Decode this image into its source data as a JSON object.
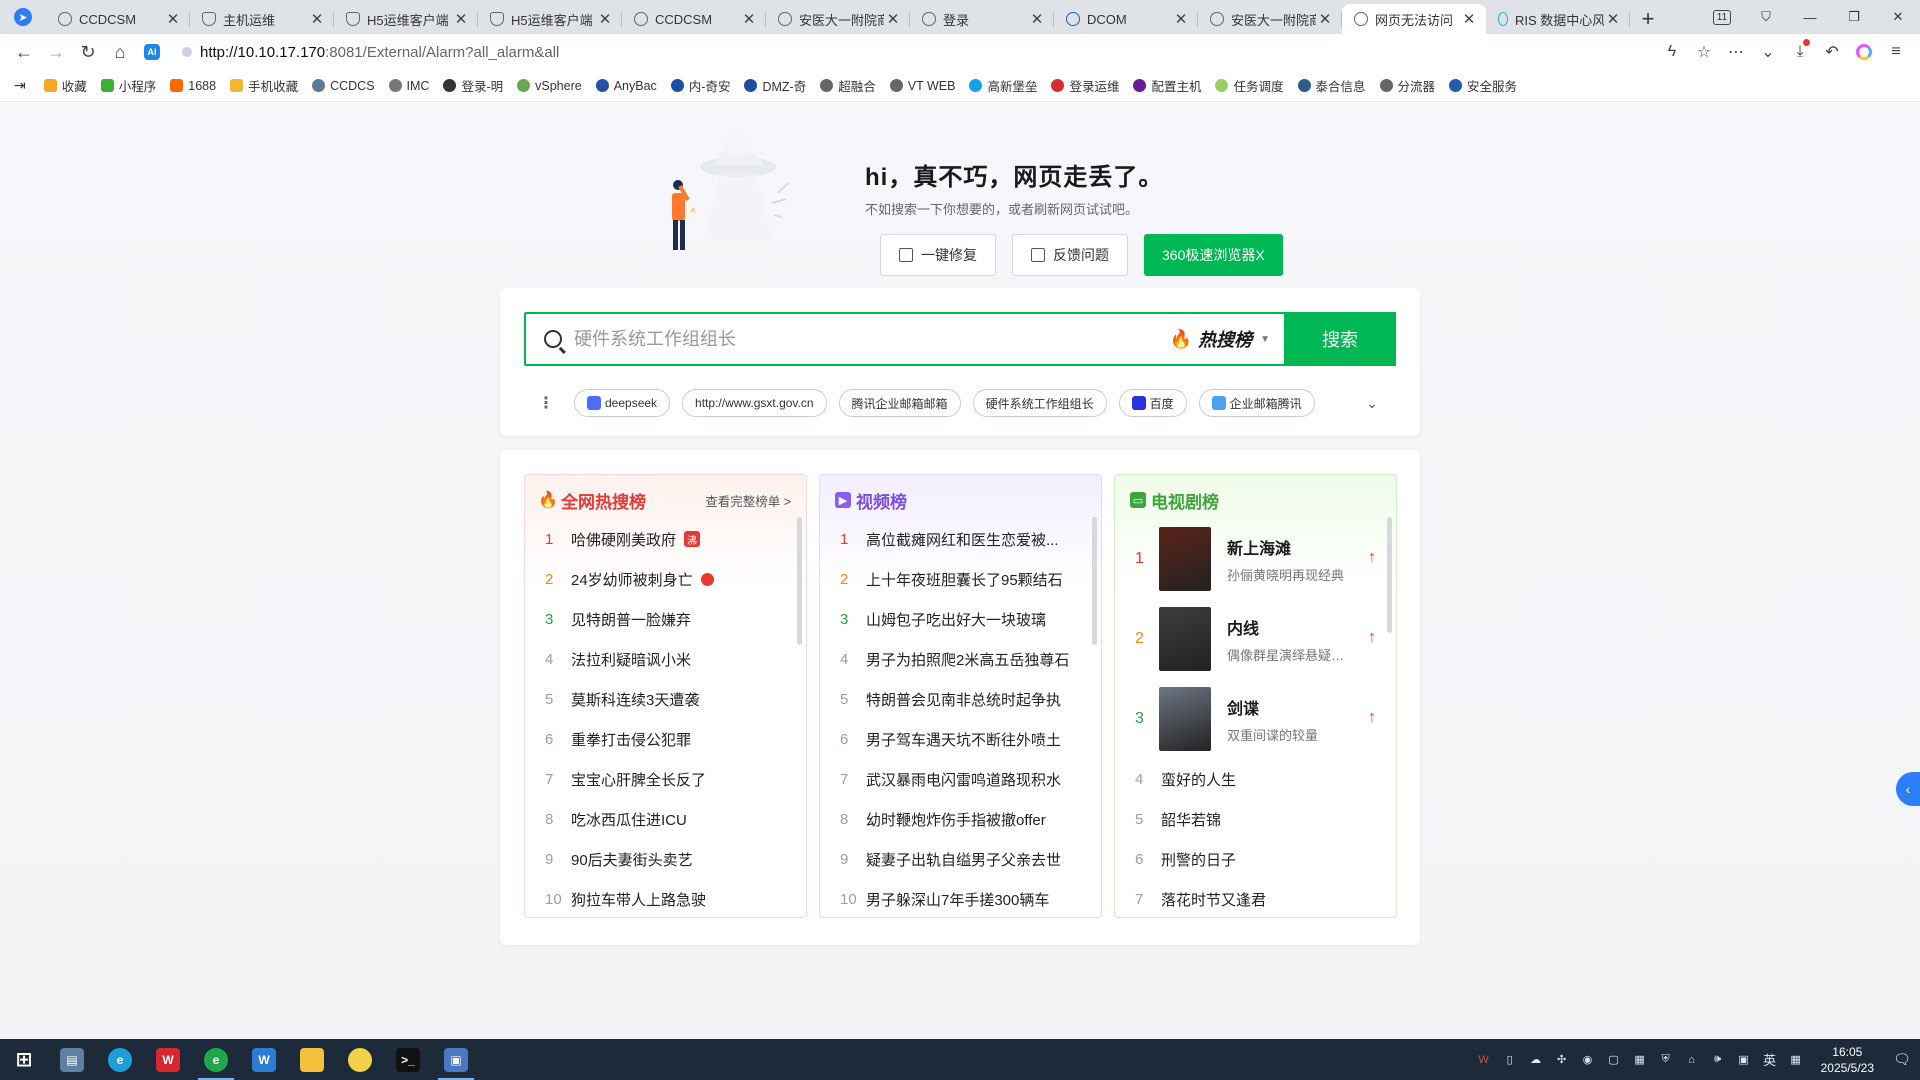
{
  "browser": {
    "tabs": [
      {
        "label": "CCDCSM",
        "icon": "ccdcsm-icon"
      },
      {
        "label": "主机运维",
        "icon": "shield-icon"
      },
      {
        "label": "H5运维客户端",
        "icon": "shield-icon"
      },
      {
        "label": "H5运维客户端",
        "icon": "shield-icon"
      },
      {
        "label": "CCDCSM",
        "icon": "ccdcsm-icon"
      },
      {
        "label": "安医大一附院商",
        "icon": "globe-icon"
      },
      {
        "label": "登录",
        "icon": "globe-icon"
      },
      {
        "label": "DCOM",
        "icon": "dcom-icon"
      },
      {
        "label": "安医大一附院商",
        "icon": "globe-icon"
      },
      {
        "label": "网页无法访问",
        "icon": "globe-icon",
        "active": true
      },
      {
        "label": "RIS 数据中心风",
        "icon": "ris-icon"
      }
    ],
    "tab_count": "11",
    "url_host": "http://10.10.17.170",
    "url_rest": ":8081/External/Alarm?all_alarm&all",
    "bookmarks": [
      {
        "label": "收藏",
        "color": "#f5a623"
      },
      {
        "label": "小程序",
        "color": "#3cb034"
      },
      {
        "label": "1688",
        "color": "#ff6a00"
      },
      {
        "label": "手机收藏",
        "color": "#f2b632"
      },
      {
        "label": "CCDCS",
        "color": "#5d7a94"
      },
      {
        "label": "IMC",
        "color": "#777777"
      },
      {
        "label": "登录-明",
        "color": "#333333"
      },
      {
        "label": "vSphere",
        "color": "#6aa84f"
      },
      {
        "label": "AnyBac",
        "color": "#2451a6"
      },
      {
        "label": "内-奇安",
        "color": "#1c4fa3"
      },
      {
        "label": "DMZ-奇",
        "color": "#1c4fa3"
      },
      {
        "label": "超融合",
        "color": "#666666"
      },
      {
        "label": "VT WEB",
        "color": "#666666"
      },
      {
        "label": "高新堡垒",
        "color": "#1aa0e8"
      },
      {
        "label": "登录运维",
        "color": "#d32f2f"
      },
      {
        "label": "配置主机",
        "color": "#6a1b9a"
      },
      {
        "label": "任务调度",
        "color": "#9ccc65"
      },
      {
        "label": "泰合信息",
        "color": "#2e5c8a"
      },
      {
        "label": "分流器",
        "color": "#666666"
      },
      {
        "label": "安全服务",
        "color": "#1f5fa8"
      }
    ],
    "bookmark_prefix_1688": "1688"
  },
  "hero": {
    "title": "hi，真不巧，网页走丢了。",
    "subtitle": "不如搜索一下你想要的，或者刷新网页试试吧。",
    "buttons": {
      "repair": "一键修复",
      "feedback": "反馈问题",
      "browser": "360极速浏览器X"
    }
  },
  "search": {
    "placeholder": "硬件系统工作组组长",
    "hot_label": "热搜榜",
    "button": "搜索",
    "chips": [
      {
        "label": "deepseek",
        "color": "#4d6bfe"
      },
      {
        "label": "http://www.gsxt.gov.cn",
        "color": ""
      },
      {
        "label": "腾讯企业邮箱邮箱",
        "color": ""
      },
      {
        "label": "硬件系统工作组组长",
        "color": ""
      },
      {
        "label": "百度",
        "color": "#2932e1"
      },
      {
        "label": "企业邮箱腾讯",
        "color": "#4aa3f0"
      }
    ]
  },
  "lists": {
    "hot": {
      "title": "全网热搜榜",
      "link": "查看完整榜单 >",
      "title_color": "#e53935",
      "items": [
        {
          "rank": "1",
          "text": "哈佛硬刚美政府",
          "tag": "沸"
        },
        {
          "rank": "2",
          "text": "24岁幼师被刺身亡",
          "tag": "dot"
        },
        {
          "rank": "3",
          "text": "见特朗普一脸嫌弃"
        },
        {
          "rank": "4",
          "text": "法拉利疑暗讽小米"
        },
        {
          "rank": "5",
          "text": "莫斯科连续3天遭袭"
        },
        {
          "rank": "6",
          "text": "重拳打击侵公犯罪"
        },
        {
          "rank": "7",
          "text": "宝宝心肝脾全长反了"
        },
        {
          "rank": "8",
          "text": "吃冰西瓜住进ICU"
        },
        {
          "rank": "9",
          "text": "90后夫妻街头卖艺"
        },
        {
          "rank": "10",
          "text": "狗拉车带人上路急驶"
        }
      ]
    },
    "video": {
      "title": "视频榜",
      "title_color": "#7b4ee0",
      "items": [
        {
          "rank": "1",
          "text": "高位截瘫网红和医生恋爱被..."
        },
        {
          "rank": "2",
          "text": "上十年夜班胆囊长了95颗结石"
        },
        {
          "rank": "3",
          "text": "山姆包子吃出好大一块玻璃"
        },
        {
          "rank": "4",
          "text": "男子为拍照爬2米高五岳独尊石"
        },
        {
          "rank": "5",
          "text": "特朗普会见南非总统时起争执"
        },
        {
          "rank": "6",
          "text": "男子驾车遇天坑不断往外喷土"
        },
        {
          "rank": "7",
          "text": "武汉暴雨电闪雷鸣道路现积水"
        },
        {
          "rank": "8",
          "text": "幼时鞭炮炸伤手指被撤offer"
        },
        {
          "rank": "9",
          "text": "疑妻子出轨自缢男子父亲去世"
        },
        {
          "rank": "10",
          "text": "男子躲深山7年手搓300辆车"
        }
      ]
    },
    "tv": {
      "title": "电视剧榜",
      "title_color": "#3fa63f",
      "featured": [
        {
          "rank": "1",
          "title": "新上海滩",
          "desc": "孙俪黄晓明再现经典",
          "poster_color": "#5a2418"
        },
        {
          "rank": "2",
          "title": "内线",
          "desc": "偶像群星演绎悬疑谍战",
          "poster_color": "#3d3d40"
        },
        {
          "rank": "3",
          "title": "剑谍",
          "desc": "双重间谍的较量",
          "poster_color": "#6e7683"
        }
      ],
      "items": [
        {
          "rank": "4",
          "text": "蛮好的人生"
        },
        {
          "rank": "5",
          "text": "韶华若锦"
        },
        {
          "rank": "6",
          "text": "刑警的日子"
        },
        {
          "rank": "7",
          "text": "落花时节又逢君"
        }
      ]
    }
  },
  "taskbar": {
    "time": "16:05",
    "date": "2025/5/23",
    "ime": "英"
  }
}
